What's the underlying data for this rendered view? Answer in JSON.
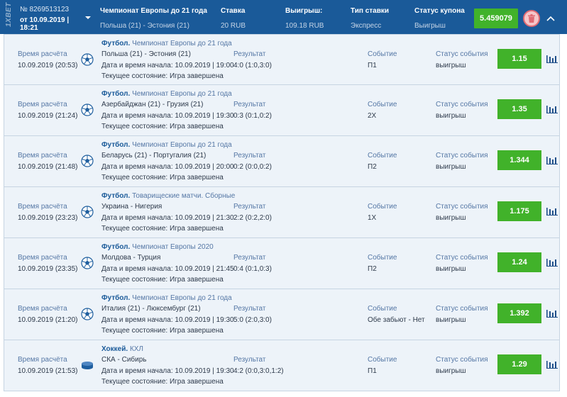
{
  "coupon": {
    "number": "№ 8269513123",
    "date": "от 10.09.2019 | 18:21",
    "logo": "1XBET",
    "tournament": "Чемпионат Европы до 21 года",
    "match": "Польша (21) - Эстония (21)",
    "stake_label": "Ставка",
    "stake_value": "20 RUB",
    "win_label": "Выигрыш:",
    "win_value": "109.18 RUB",
    "type_label": "Тип ставки",
    "type_value": "Экспресс",
    "status_label": "Статус купона",
    "status_value": "Выигрыш",
    "total_coef": "5.459079",
    "icons": {
      "expand": "chevron-down-icon",
      "delete": "trash-icon",
      "collapse": "chevron-up-icon"
    },
    "colors": {
      "header_bg": "#1a5a99",
      "coef_bg": "#41b22a",
      "trash": "#e06a73",
      "row_bg": "#edf3f9"
    }
  },
  "labels": {
    "calc": "Время расчёта",
    "result": "Результат",
    "event": "Событие",
    "event_status": "Статус события"
  },
  "events": [
    {
      "calc_time": "10.09.2019 (20:53)",
      "sport": "Футбол.",
      "league": "Чемпионат Европы до 21 года",
      "teams": "Польша (21) - Эстония (21)",
      "start": "Дата и время начала: 10.09.2019 | 19:00",
      "state": "Текущее состояние: Игра завершена",
      "result": "4:0 (1:0,3:0)",
      "event": "П1",
      "status": "выигрыш",
      "coef": "1.15",
      "icon": "soccer-ball-icon"
    },
    {
      "calc_time": "10.09.2019 (21:24)",
      "sport": "Футбол.",
      "league": "Чемпионат Европы до 21 года",
      "teams": "Азербайджан (21) - Грузия (21)",
      "start": "Дата и время начала: 10.09.2019 | 19:30",
      "state": "Текущее состояние: Игра завершена",
      "result": "0:3 (0:1,0:2)",
      "event": "2Х",
      "status": "выигрыш",
      "coef": "1.35",
      "icon": "soccer-ball-icon"
    },
    {
      "calc_time": "10.09.2019 (21:48)",
      "sport": "Футбол.",
      "league": "Чемпионат Европы до 21 года",
      "teams": "Беларусь (21) - Португалия (21)",
      "start": "Дата и время начала: 10.09.2019 | 20:00",
      "state": "Текущее состояние: Игра завершена",
      "result": "0:2 (0:0,0:2)",
      "event": "П2",
      "status": "выигрыш",
      "coef": "1.344",
      "icon": "soccer-ball-icon"
    },
    {
      "calc_time": "10.09.2019 (23:23)",
      "sport": "Футбол.",
      "league": "Товарищеские матчи. Сборные",
      "teams": "Украина - Нигерия",
      "start": "Дата и время начала: 10.09.2019 | 21:30",
      "state": "Текущее состояние: Игра завершена",
      "result": "2:2 (0:2,2:0)",
      "event": "1Х",
      "status": "выигрыш",
      "coef": "1.175",
      "icon": "soccer-ball-icon"
    },
    {
      "calc_time": "10.09.2019 (23:35)",
      "sport": "Футбол.",
      "league": "Чемпионат Европы 2020",
      "teams": "Молдова - Турция",
      "start": "Дата и время начала: 10.09.2019 | 21:45",
      "state": "Текущее состояние: Игра завершена",
      "result": "0:4 (0:1,0:3)",
      "event": "П2",
      "status": "выигрыш",
      "coef": "1.24",
      "icon": "soccer-ball-icon"
    },
    {
      "calc_time": "10.09.2019 (21:20)",
      "sport": "Футбол.",
      "league": "Чемпионат Европы до 21 года",
      "teams": "Италия (21) - Люксембург (21)",
      "start": "Дата и время начала: 10.09.2019 | 19:30",
      "state": "Текущее состояние: Игра завершена",
      "result": "5:0 (2:0,3:0)",
      "event": "Обе забьют - Нет",
      "status": "выигрыш",
      "coef": "1.392",
      "icon": "soccer-ball-icon"
    },
    {
      "calc_time": "10.09.2019 (21:53)",
      "sport": "Хоккей.",
      "league": "КХЛ",
      "teams": "СКА - Сибирь",
      "start": "Дата и время начала: 10.09.2019 | 19:30",
      "state": "Текущее состояние: Игра завершена",
      "result": "4:2 (0:0,3:0,1:2)",
      "event": "П1",
      "status": "выигрыш",
      "coef": "1.29",
      "icon": "hockey-puck-icon"
    }
  ]
}
